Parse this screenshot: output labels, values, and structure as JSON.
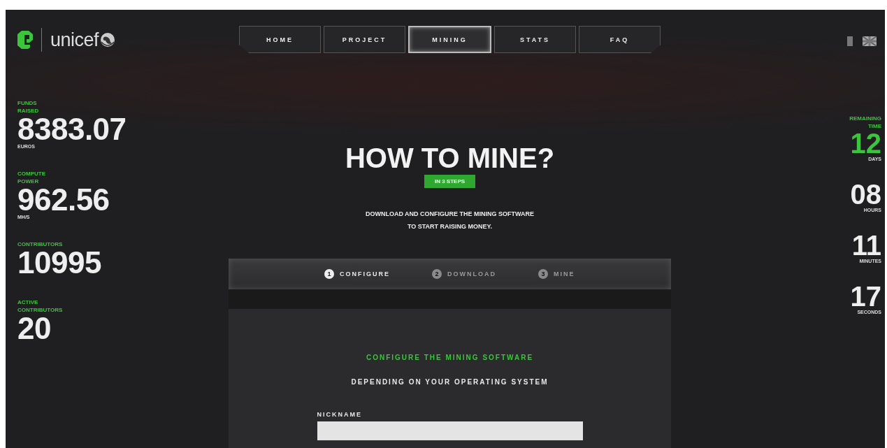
{
  "logo": {
    "text": "unicef"
  },
  "nav": [
    {
      "label": "HOME",
      "selected": false
    },
    {
      "label": "PROJECT",
      "selected": false
    },
    {
      "label": "MINING",
      "selected": true
    },
    {
      "label": "STATS",
      "selected": false
    },
    {
      "label": "FAQ",
      "selected": false
    }
  ],
  "stats": [
    {
      "label": "FUNDS RAISED",
      "value": "8383.07",
      "unit": "EUROS"
    },
    {
      "label": "COMPUTE POWER",
      "value": "962.56",
      "unit": "MH/S"
    },
    {
      "label": "CONTRIBUTORS",
      "value": "10995"
    },
    {
      "label": "ACTIVE CONTRIBUTORS",
      "value": "20"
    }
  ],
  "remaining_time": {
    "label": "REMAINING TIME",
    "units": [
      {
        "value": "12",
        "unit": "DAYS",
        "highlighted": true
      },
      {
        "value": "08",
        "unit": "HOURS",
        "highlighted": false
      },
      {
        "value": "11",
        "unit": "MINUTES",
        "highlighted": false
      },
      {
        "value": "17",
        "unit": "SECONDS",
        "highlighted": false
      }
    ]
  },
  "heading": "HOW TO MINE?",
  "badge": "IN 3 STEPS",
  "intro": "DOWNLOAD AND CONFIGURE THE MINING SOFTWARE\nTO START RAISING MONEY.",
  "steps": [
    {
      "number": "1",
      "label": "CONFIGURE",
      "selected": true
    },
    {
      "number": "2",
      "label": "DOWNLOAD",
      "selected": false
    },
    {
      "number": "3",
      "label": "MINE",
      "selected": false
    }
  ],
  "form": {
    "title": "CONFIGURE THE MINING SOFTWARE",
    "subtitle": "DEPENDING ON YOUR OPERATING SYSTEM",
    "fields": [
      {
        "label": "NICKNAME"
      }
    ]
  }
}
